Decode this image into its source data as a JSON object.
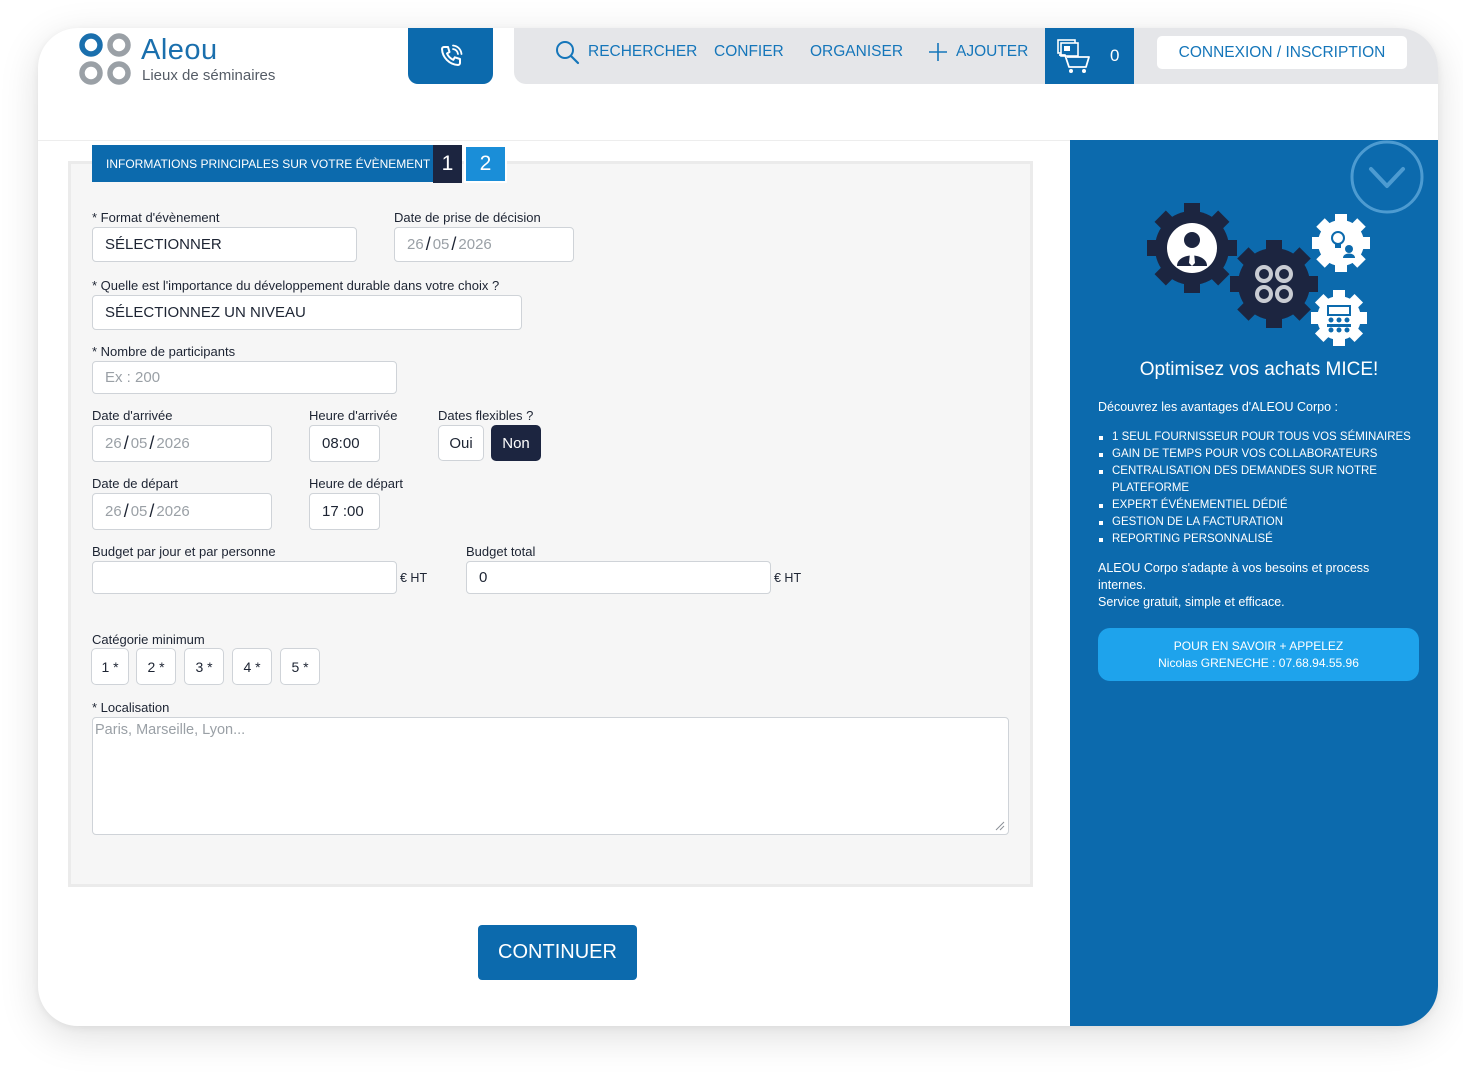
{
  "brand": {
    "name": "Aleou",
    "tagline": "Lieux de séminaires"
  },
  "nav": {
    "search": "RECHERCHER",
    "entrust": "CONFIER",
    "organize": "ORGANISER",
    "add": "AJOUTER",
    "cart_count": "0",
    "login": "CONNEXION / INSCRIPTION"
  },
  "form": {
    "step_title": "INFORMATIONS PRINCIPALES SUR VOTRE ÉVÈNEMENT",
    "steps": [
      "1",
      "2"
    ],
    "format_label": "* Format d'évènement",
    "format_value": "SÉLECTIONNER",
    "decision_label": "Date de prise de décision",
    "decision_date": {
      "day": "26",
      "month": "05",
      "year": "2026"
    },
    "sustain_label": "* Quelle est l'importance du développement durable dans votre choix ?",
    "sustain_value": "SÉLECTIONNEZ UN NIVEAU",
    "participants_label": "* Nombre de participants",
    "participants_placeholder": "Ex : 200",
    "arrival_date_label": "Date d'arrivée",
    "arrival_date": {
      "day": "26",
      "month": "05",
      "year": "2026"
    },
    "arrival_time_label": "Heure d'arrivée",
    "arrival_time": "08:00",
    "flexible_label": "Dates flexibles ?",
    "flexible_yes": "Oui",
    "flexible_no": "Non",
    "departure_date_label": "Date de départ",
    "departure_date": {
      "day": "26",
      "month": "05",
      "year": "2026"
    },
    "departure_time_label": "Heure de départ",
    "departure_time": "17 :00",
    "budget_day_label": "Budget par jour et par personne",
    "budget_day_value": "",
    "budget_total_label": "Budget total",
    "budget_total_value": "0",
    "currency_unit": "€ HT",
    "category_label": "Catégorie minimum",
    "categories": [
      "1 *",
      "2 *",
      "3 *",
      "4 *",
      "5 *"
    ],
    "location_label": "* Localisation",
    "location_placeholder": "Paris, Marseille, Lyon...",
    "continue": "CONTINUER"
  },
  "sidebar": {
    "title": "Optimisez vos achats MICE!",
    "intro": "Découvrez les avantages d'ALEOU Corpo :",
    "benefits": [
      "1 SEUL FOURNISSEUR POUR TOUS VOS SÉMINAIRES",
      "GAIN DE TEMPS POUR VOS COLLABORATEURS",
      "CENTRALISATION DES DEMANDES SUR NOTRE PLATEFORME",
      "EXPERT ÉVÉNEMENTIEL DÉDIÉ",
      "GESTION DE LA FACTURATION",
      "REPORTING PERSONNALISÉ"
    ],
    "desc_line1": "ALEOU Corpo s'adapte à vos besoins et process internes.",
    "desc_line2": "Service gratuit, simple et efficace.",
    "cta_line1": "POUR EN SAVOIR + APPELEZ",
    "cta_line2": "Nicolas GRENECHE : 07.68.94.55.96"
  },
  "icons": {
    "phone": "phone-icon",
    "search": "search-icon",
    "add": "plus-icon",
    "cart": "cart-icon",
    "collapse": "chevron-down-icon",
    "illustration": "gears-illustration"
  },
  "colors": {
    "primary": "#0c6aad",
    "dark": "#1c2540",
    "link": "#1576ba",
    "cta": "#1ea3ec",
    "nav_bg": "#e5e6e9"
  }
}
